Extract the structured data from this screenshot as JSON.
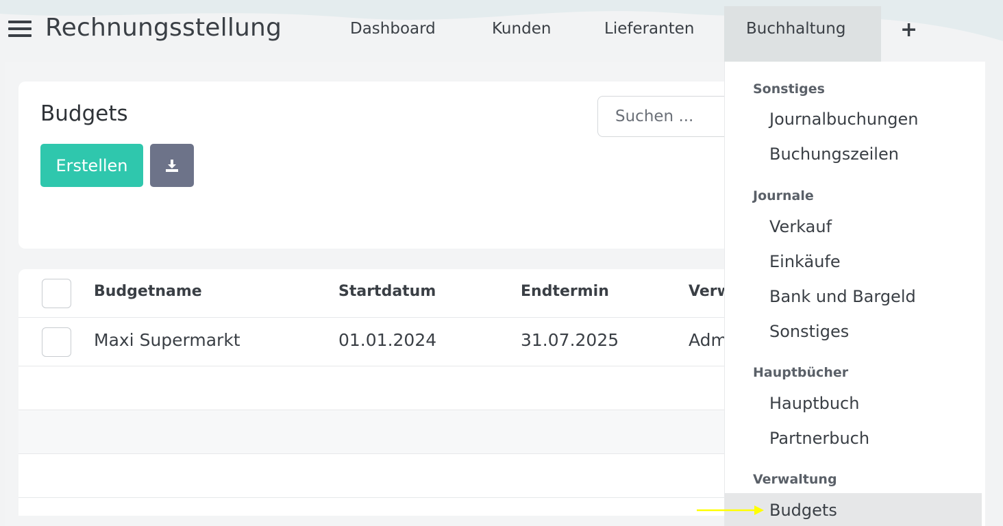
{
  "navbar": {
    "app_title": "Rechnungsstellung",
    "items": [
      {
        "label": "Dashboard"
      },
      {
        "label": "Kunden"
      },
      {
        "label": "Lieferanten"
      },
      {
        "label": "Buchhaltung"
      }
    ],
    "plus_label": "+"
  },
  "page": {
    "title": "Budgets",
    "create_label": "Erstellen",
    "download_icon": "download-icon",
    "search_placeholder": "Suchen ..."
  },
  "table": {
    "columns": [
      "Budgetname",
      "Startdatum",
      "Endtermin",
      "Verw"
    ],
    "rows": [
      [
        "Maxi Supermarkt",
        "01.01.2024",
        "31.07.2025",
        "Adm"
      ]
    ]
  },
  "dropdown": {
    "sections": [
      {
        "title": "Sonstiges",
        "items": [
          "Journalbuchungen",
          "Buchungszeilen"
        ]
      },
      {
        "title": "Journale",
        "items": [
          "Verkauf",
          "Einkäufe",
          "Bank und Bargeld",
          "Sonstiges"
        ]
      },
      {
        "title": "Hauptbücher",
        "items": [
          "Hauptbuch",
          "Partnerbuch"
        ]
      },
      {
        "title": "Verwaltung",
        "items": [
          "Budgets"
        ]
      }
    ],
    "active_item": "Budgets"
  },
  "colors": {
    "accent": "#2fc7ad",
    "download_button": "#6d7389",
    "annotation_arrow": "#ffff00"
  }
}
